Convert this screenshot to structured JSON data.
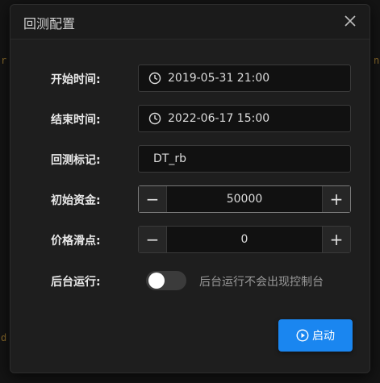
{
  "background": {
    "left_glyph_1": "r",
    "left_glyph_2": "d",
    "right_glyph": "n"
  },
  "dialog": {
    "title": "回测配置",
    "close_icon": "close-icon"
  },
  "form": {
    "start_time": {
      "label": "开始时间:",
      "value": "2019-05-31 21:00",
      "icon": "clock-icon"
    },
    "end_time": {
      "label": "结束时间:",
      "value": "2022-06-17 15:00",
      "icon": "clock-icon"
    },
    "tag": {
      "label": "回测标记:",
      "value": "DT_rb"
    },
    "capital": {
      "label": "初始资金:",
      "value": "50000",
      "minus": "−",
      "plus": "+"
    },
    "slippage": {
      "label": "价格滑点:",
      "value": "0",
      "minus": "−",
      "plus": "+"
    },
    "background_run": {
      "label": "后台运行:",
      "hint": "后台运行不会出现控制台",
      "enabled": false
    }
  },
  "actions": {
    "start_label": "启动",
    "start_icon": "play-circle-icon"
  },
  "colors": {
    "accent": "#1a86f0",
    "dialog_bg": "#1e1e1e",
    "field_bg": "#111111"
  }
}
